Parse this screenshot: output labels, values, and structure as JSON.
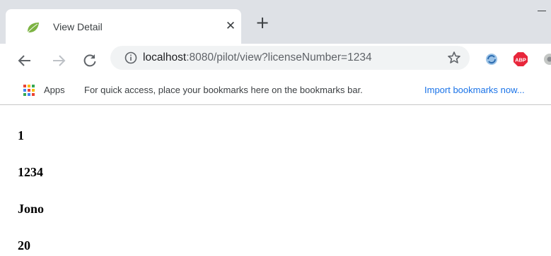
{
  "tab": {
    "title": "View Detail",
    "close_glyph": "✕",
    "favicon": "leaf-icon"
  },
  "new_tab_glyph": "+",
  "address_bar": {
    "host": "localhost",
    "path": ":8080/pilot/view?licenseNumber=1234"
  },
  "bookmarks_bar": {
    "apps_label": "Apps",
    "hint": "For quick access, place your bookmarks here on the bookmarks bar.",
    "import_link": "Import bookmarks now..."
  },
  "extensions": {
    "abp_label": "ABP"
  },
  "page": {
    "values": [
      "1",
      "1234",
      "Jono",
      "20"
    ]
  },
  "colors": {
    "tab_strip": "#dee1e6",
    "link": "#1a73e8",
    "abp_red": "#e8263b",
    "favicon_green": "#7cb342"
  }
}
